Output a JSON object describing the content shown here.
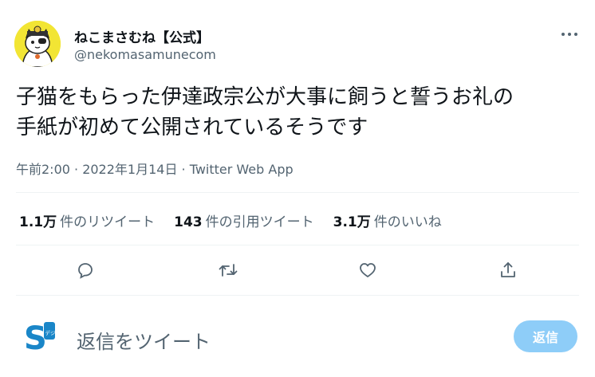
{
  "author": {
    "display_name": "ねこまさむね【公式】",
    "handle": "@nekomasamunecom"
  },
  "tweet": {
    "text_line1": "子猫をもらった伊達政宗公が大事に飼うと誓うお礼の",
    "text_line2": "手紙が初めて公開されているそうです",
    "timestamp": "午前2:00 · 2022年1月14日 · Twitter Web App"
  },
  "stats": {
    "retweets_count": "1.1万",
    "retweets_label": "件のリツイート",
    "quotes_count": "143",
    "quotes_label": "件の引用ツイート",
    "likes_count": "3.1万",
    "likes_label": "件のいいね"
  },
  "actions": [
    "reply-icon",
    "retweet-icon",
    "like-icon",
    "share-icon"
  ],
  "reply_bar": {
    "placeholder": "返信をツイート",
    "button_label": "返信",
    "avatar_text": "S",
    "avatar_sub": "デジ"
  },
  "colors": {
    "accent": "#1d9bf0",
    "reply_button": "#8ecdf8",
    "muted": "#536471",
    "text": "#0f1419"
  }
}
